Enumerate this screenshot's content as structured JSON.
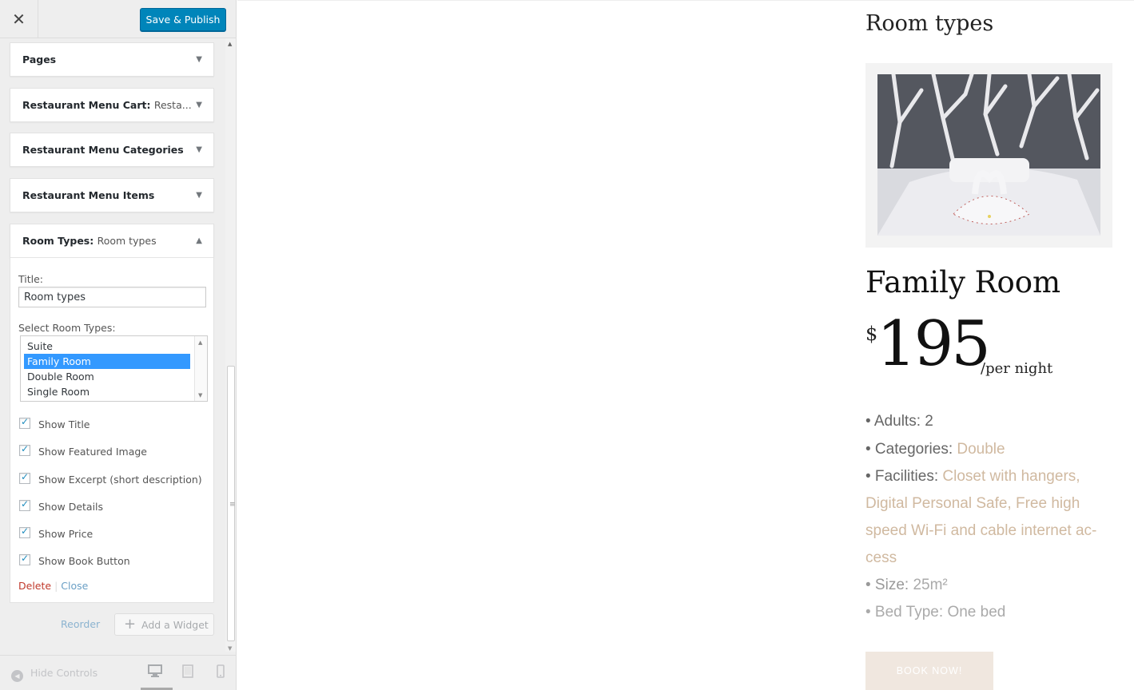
{
  "topbar": {
    "close_glyph": "✕",
    "publish_label": "Save & Publish"
  },
  "widgets": [
    {
      "title": "Pages",
      "subtitle": ""
    },
    {
      "title": "Restaurant Menu Cart:",
      "subtitle": "Resta..."
    },
    {
      "title": "Restaurant Menu Categories",
      "subtitle": ""
    },
    {
      "title": "Restaurant Menu Items",
      "subtitle": ""
    },
    {
      "title": "Room Types:",
      "subtitle": "Room types"
    }
  ],
  "room_widget": {
    "title_label": "Title:",
    "title_value": "Room types",
    "select_label": "Select Room Types:",
    "options": [
      "Suite",
      "Family Room",
      "Double Room",
      "Single Room"
    ],
    "selected_option": "Family Room",
    "checkboxes": [
      {
        "label": "Show Title",
        "checked": true
      },
      {
        "label": "Show Featured Image",
        "checked": true
      },
      {
        "label": "Show Excerpt (short description)",
        "checked": true
      },
      {
        "label": "Show Details",
        "checked": true
      },
      {
        "label": "Show Price",
        "checked": true
      },
      {
        "label": "Show Book Button",
        "checked": true
      }
    ],
    "delete_label": "Delete",
    "separator": "|",
    "close_label": "Close"
  },
  "sidebar_footer": {
    "reorder_label": "Reorder",
    "add_widget_label": "Add a Widget",
    "hide_controls_label": "Hide Controls",
    "devices": [
      "desktop-icon",
      "tablet-icon",
      "mobile-icon"
    ],
    "active_device": "desktop"
  },
  "preview": {
    "heading": "Room types",
    "room_title": "Family Room",
    "currency": "$",
    "price": "195",
    "price_period": "/per night",
    "details": [
      {
        "label": "• Adults:",
        "value": "2"
      },
      {
        "label": "• Categories:",
        "value": "Double"
      },
      {
        "label": "• Facilities:",
        "value_line1": "Closet with hangers,",
        "value_line2": "Digital Personal Safe, Free high",
        "value_line3": "speed Wi-Fi and cable internet ac-",
        "value_line4": "cess"
      },
      {
        "label": "• Size:",
        "value": "25m²"
      },
      {
        "label": "• Bed Type:",
        "value": "One bed"
      }
    ],
    "book_label": "BOOK NOW!"
  },
  "colors": {
    "publish_blue": "#0085ba",
    "selection_blue": "#3399ff",
    "accent_beige": "#d0b9a0",
    "delete_red": "#c0392b"
  }
}
